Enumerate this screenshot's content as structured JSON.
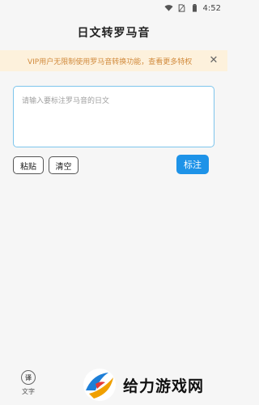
{
  "status": {
    "time": "4:52"
  },
  "header": {
    "title": "日文转罗马音"
  },
  "notice": {
    "text": "VIP用户无限制使用罗马音转换功能，查看更多特权"
  },
  "editor": {
    "placeholder": "请输入要标注罗马音的日文",
    "value": ""
  },
  "actions": {
    "paste_label": "粘贴",
    "clear_label": "清空",
    "annotate_label": "标注"
  },
  "tabbar": {
    "tab_icon_glyph": "译",
    "tab_label": "文字"
  },
  "watermark": {
    "text": "给力游戏网"
  },
  "colors": {
    "accent": "#1e93e8",
    "border": "#7dc5ec",
    "notice_bg": "#fdf1dc",
    "notice_text": "#d18a3c"
  }
}
